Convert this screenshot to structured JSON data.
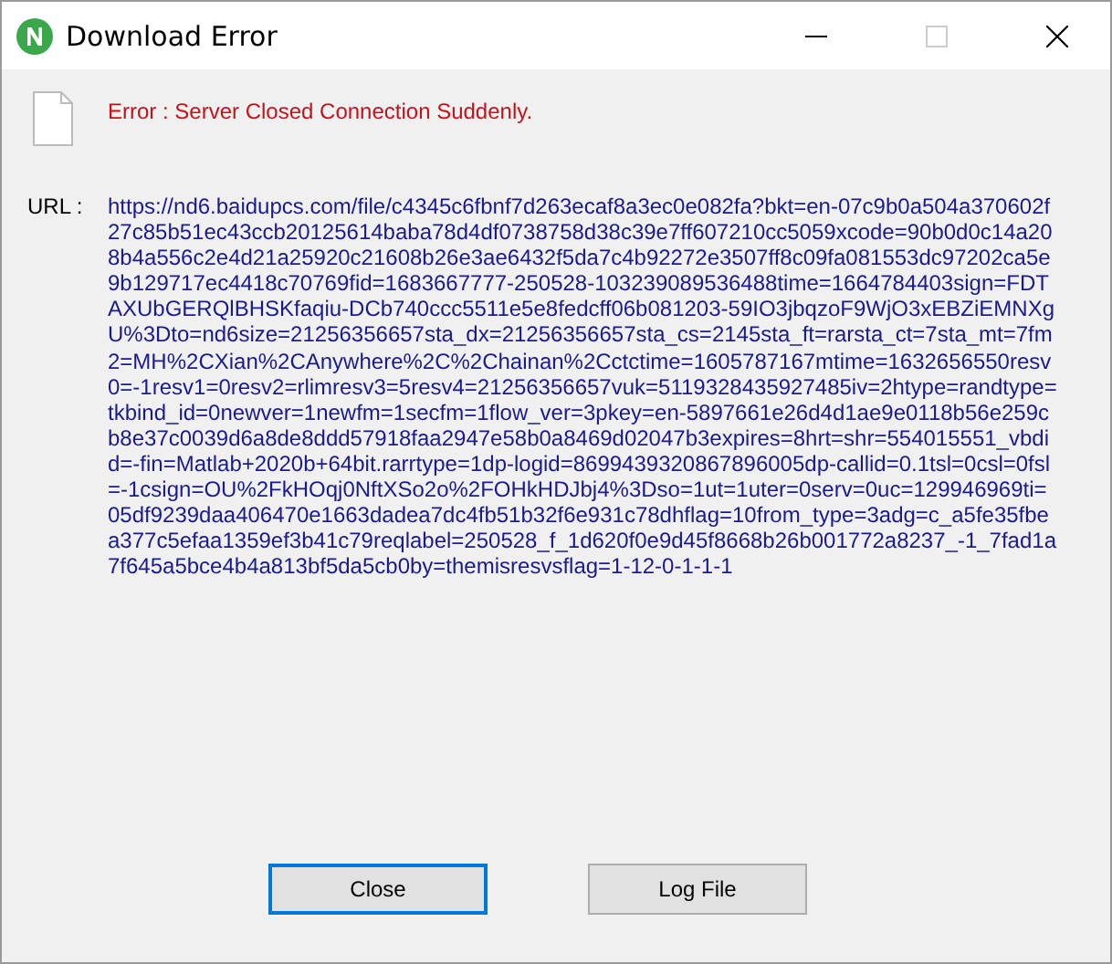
{
  "window": {
    "title": "Download Error"
  },
  "error": {
    "message": "Error : Server Closed Connection Suddenly."
  },
  "url": {
    "label": "URL :",
    "value": "https://nd6.baidupcs.com/file/c4345c6fbnf7d263ecaf8a3ec0e082fa?bkt=en-07c9b0a504a370602f27c85b51ec43ccb20125614baba78d4df0738758d38c39e7ff607210cc5059xcode=90b0d0c14a208b4a556c2e4d21a25920c21608b26e3ae6432f5da7c4b92272e3507ff8c09fa081553dc97202ca5e9b129717ec4418c70769fid=1683667777-250528-103239089536488time=1664784403sign=FDTAXUbGERQlBHSKfaqiu-DCb740ccc5511e5e8fedcff06b081203-59IO3jbqzoF9WjO3xEBZiEMNXgU%3Dto=nd6size=21256356657sta_dx=21256356657sta_cs=2145sta_ft=rarsta_ct=7sta_mt=7fm2=MH%2CXian%2CAnywhere%2C%2Chainan%2Cctctime=1605787167mtime=1632656550resv0=-1resv1=0resv2=rlimresv3=5resv4=21256356657vuk=5119328435927485iv=2htype=randtype=tkbind_id=0newver=1newfm=1secfm=1flow_ver=3pkey=en-5897661e26d4d1ae9e0118b56e259cb8e37c0039d6a8de8ddd57918faa2947e58b0a8469d02047b3expires=8hrt=shr=554015551_vbdid=-fin=Matlab+2020b+64bit.rarrtype=1dp-logid=8699439320867896005dp-callid=0.1tsl=0csl=0fsl=-1csign=OU%2FkHOqj0NftXSo2o%2FOHkHDJbj4%3Dso=1ut=1uter=0serv=0uc=129946969ti=05df9239daa406470e1663dadea7dc4fb51b32f6e931c78dhflag=10from_type=3adg=c_a5fe35fbea377c5efaa1359ef3b41c79reqlabel=250528_f_1d620f0e9d45f8668b26b001772a8237_-1_7fad1a7f645a5bce4b4a813bf5da5cb0by=themisresvsflag=1-12-0-1-1-1"
  },
  "buttons": [
    {
      "label": "Close",
      "default": true
    },
    {
      "label": "Log File",
      "default": false
    }
  ]
}
